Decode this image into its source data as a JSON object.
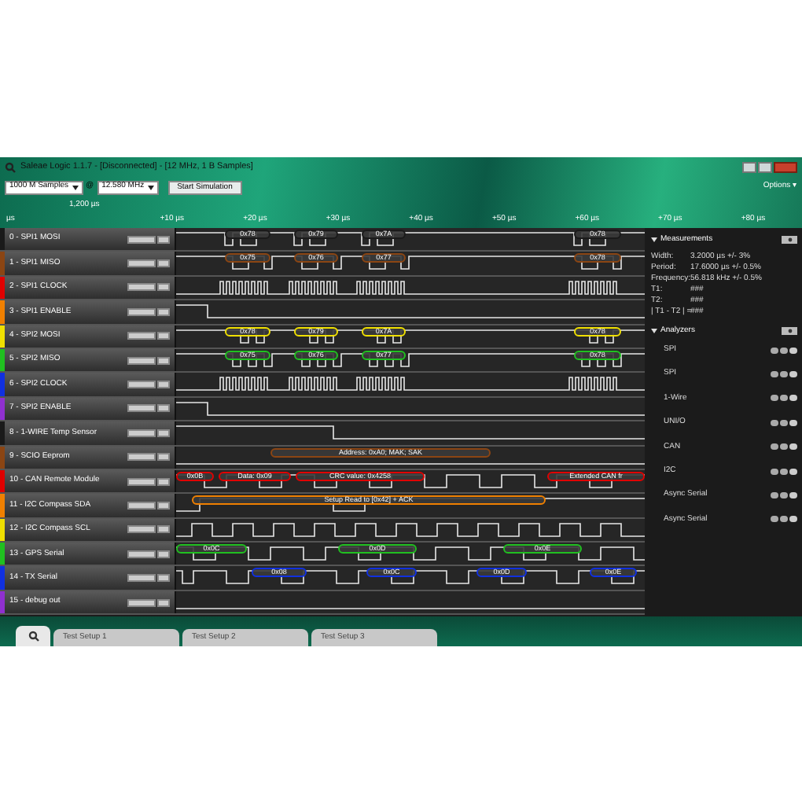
{
  "window": {
    "title": "Saleae Logic 1.1.7 - [Disconnected] - [12 MHz, 1 B Samples]"
  },
  "toolbar": {
    "samples": "1000 M Samples",
    "at": "@",
    "rate": "12.580 MHz",
    "start_button": "Start Simulation",
    "options": "Options ▾"
  },
  "ruler": {
    "cursor": "1,200 µs",
    "unit": "µs",
    "ticks": [
      "+10 µs",
      "+20 µs",
      "+30 µs",
      "+40 µs",
      "+50 µs",
      "+60 µs",
      "+70 µs",
      "+80 µs"
    ]
  },
  "channels": [
    {
      "name": "0 - SPI1 MOSI",
      "color": "#1a1a1a",
      "kind": "data",
      "bubbles": [
        "0x78",
        "0x79",
        "0x7A",
        "0x78"
      ]
    },
    {
      "name": "1 - SPI1 MISO",
      "color": "#8b4513",
      "kind": "data",
      "bubbles": [
        "0x75",
        "0x76",
        "0x77",
        "0x78"
      ]
    },
    {
      "name": "2 - SPI1 CLOCK",
      "color": "#e00000",
      "kind": "clock"
    },
    {
      "name": "3 - SPI1 ENABLE",
      "color": "#f08000",
      "kind": "enable"
    },
    {
      "name": "4 - SPI2 MOSI",
      "color": "#f0e000",
      "kind": "data",
      "bubbles": [
        "0x78",
        "0x79",
        "0x7A",
        "0x78"
      ]
    },
    {
      "name": "5 - SPI2 MISO",
      "color": "#20c020",
      "kind": "data",
      "bubbles": [
        "0x75",
        "0x76",
        "0x77",
        "0x78"
      ]
    },
    {
      "name": "6 - SPI2 CLOCK",
      "color": "#1030e0",
      "kind": "clock"
    },
    {
      "name": "7 - SPI2 ENABLE",
      "color": "#9030d0",
      "kind": "enable"
    },
    {
      "name": "8 - 1-WIRE Temp Sensor",
      "color": "#1a1a1a",
      "kind": "onewire"
    },
    {
      "name": "9 - SCIO Eeprom",
      "color": "#8b4513",
      "kind": "idle",
      "bubbles": [
        "Address: 0xA0; MAK; SAK"
      ]
    },
    {
      "name": "10 - CAN Remote Module",
      "color": "#e00000",
      "kind": "serial",
      "bubbles": [
        "0x0B",
        "Data: 0x09",
        "CRC value: 0x4258",
        "Extended CAN fr"
      ]
    },
    {
      "name": "11 - I2C Compass SDA",
      "color": "#f08000",
      "kind": "sda",
      "bubbles": [
        "Setup Read to [0x42] + ACK"
      ]
    },
    {
      "name": "12 - I2C Compass SCL",
      "color": "#f0e000",
      "kind": "scl"
    },
    {
      "name": "13 - GPS Serial",
      "color": "#20c020",
      "kind": "serial",
      "bubbles": [
        "0x0C",
        "0x0D",
        "0x0E"
      ]
    },
    {
      "name": "14 - TX Serial",
      "color": "#1030e0",
      "kind": "serial",
      "bubbles": [
        "0x08",
        "0x0C",
        "0x0D",
        "0x0E"
      ]
    },
    {
      "name": "15 - debug out",
      "color": "#9030d0",
      "kind": "idle"
    }
  ],
  "measurements": {
    "title": "Measurements",
    "rows": [
      {
        "label": "Width:",
        "value": "3.2000 µs +/- 3%"
      },
      {
        "label": "Period:",
        "value": "17.6000 µs +/- 0.5%"
      },
      {
        "label": "Frequency:",
        "value": "56.818 kHz +/- 0.5%"
      },
      {
        "label": "T1:",
        "value": "###"
      },
      {
        "label": "T2:",
        "value": "###"
      },
      {
        "label": "| T1 - T2 | =",
        "value": "###"
      }
    ]
  },
  "analyzers": {
    "title": "Analyzers",
    "items": [
      "SPI",
      "SPI",
      "1-Wire",
      "UNI/O",
      "CAN",
      "I2C",
      "Async Serial",
      "Async Serial"
    ]
  },
  "tabs": [
    {
      "label": "Test Setup 1"
    },
    {
      "label": "Test Setup 2"
    },
    {
      "label": "Test Setup 3"
    }
  ]
}
